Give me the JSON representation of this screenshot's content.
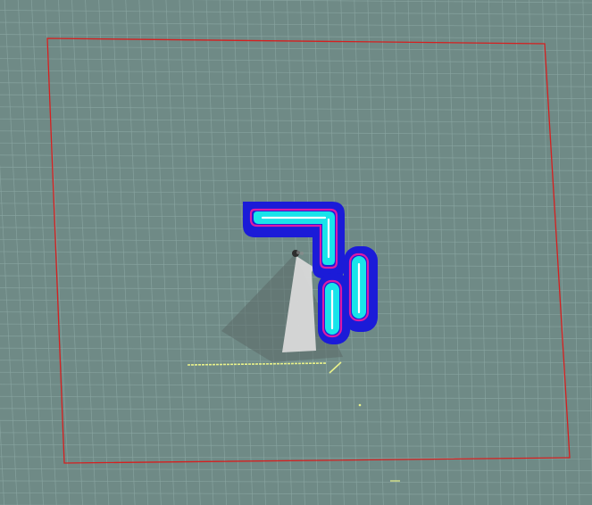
{
  "scene": {
    "background_color": "#6f8a86",
    "grid_color": "#8aa6a2",
    "boundary_color": "#d61f1f",
    "costmap_inflation_color": "#1b1bd8",
    "costmap_lethal_color": "#dd1aa6",
    "costmap_obstacle_color": "#18e4ea",
    "laser_color": "#e9f28a",
    "sensor_fov_color": "#5b6a68",
    "robot_footprint_color": "#d9d9d9"
  },
  "icons": {
    "robot": "robot-marker-icon",
    "sensor": "sensor-cone-icon"
  }
}
